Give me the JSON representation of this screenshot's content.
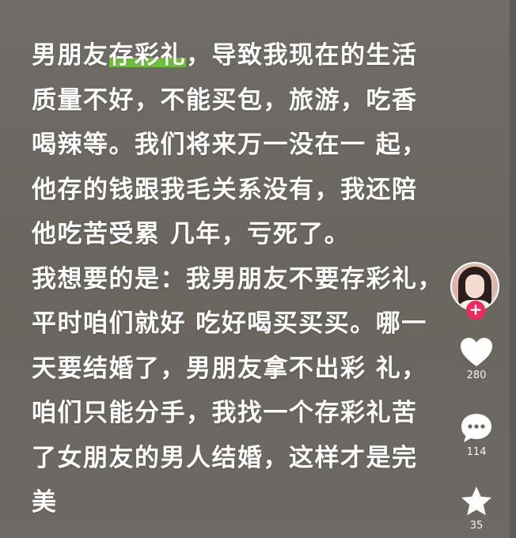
{
  "post": {
    "lines": [
      {
        "before": "男朋友",
        "highlight": "存彩礼",
        "after": "，导致我现在的生活"
      },
      {
        "text": "质量不好，不能买包，旅游，吃香"
      },
      {
        "text": "喝辣等。我们将来万一没在一 起，"
      },
      {
        "text": "他存的钱跟我毛关系没有，我还陪"
      },
      {
        "text": "他吃苦受累 几年，亏死了。"
      },
      {
        "text": "我想要的是：我男朋友不要存彩礼，"
      },
      {
        "text": "平时咱们就好 吃好喝买买买。哪一"
      },
      {
        "text": "天要结婚了，男朋友拿不出彩 礼，"
      },
      {
        "text": "咱们只能分手，我找一个存彩礼苦"
      },
      {
        "text": "了女朋友的男人结婚，这样才是完"
      },
      {
        "text": "美"
      }
    ],
    "highlight_color": "#6dbf3a",
    "text_color": "#ffffff",
    "background_color": "#6b6764"
  },
  "sidebar": {
    "avatar": {
      "icon": "avatar-portrait",
      "follow_symbol": "+",
      "follow_color": "#f0285b"
    },
    "like": {
      "icon": "heart-icon",
      "count": "280"
    },
    "comment": {
      "icon": "comment-bubble-icon",
      "count": "114"
    },
    "favorite": {
      "icon": "star-icon",
      "count": "35"
    }
  }
}
